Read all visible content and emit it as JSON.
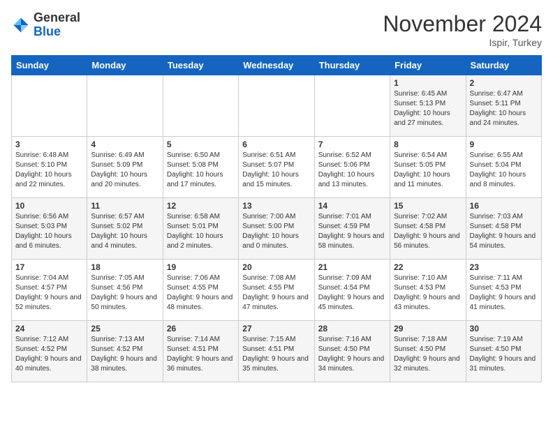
{
  "header": {
    "logo_general": "General",
    "logo_blue": "Blue",
    "month_year": "November 2024",
    "location": "Ispir, Turkey"
  },
  "days_of_week": [
    "Sunday",
    "Monday",
    "Tuesday",
    "Wednesday",
    "Thursday",
    "Friday",
    "Saturday"
  ],
  "weeks": [
    [
      {
        "day": "",
        "data": ""
      },
      {
        "day": "",
        "data": ""
      },
      {
        "day": "",
        "data": ""
      },
      {
        "day": "",
        "data": ""
      },
      {
        "day": "",
        "data": ""
      },
      {
        "day": "1",
        "data": "Sunrise: 6:45 AM\nSunset: 5:13 PM\nDaylight: 10 hours and 27 minutes."
      },
      {
        "day": "2",
        "data": "Sunrise: 6:47 AM\nSunset: 5:11 PM\nDaylight: 10 hours and 24 minutes."
      }
    ],
    [
      {
        "day": "3",
        "data": "Sunrise: 6:48 AM\nSunset: 5:10 PM\nDaylight: 10 hours and 22 minutes."
      },
      {
        "day": "4",
        "data": "Sunrise: 6:49 AM\nSunset: 5:09 PM\nDaylight: 10 hours and 20 minutes."
      },
      {
        "day": "5",
        "data": "Sunrise: 6:50 AM\nSunset: 5:08 PM\nDaylight: 10 hours and 17 minutes."
      },
      {
        "day": "6",
        "data": "Sunrise: 6:51 AM\nSunset: 5:07 PM\nDaylight: 10 hours and 15 minutes."
      },
      {
        "day": "7",
        "data": "Sunrise: 6:52 AM\nSunset: 5:06 PM\nDaylight: 10 hours and 13 minutes."
      },
      {
        "day": "8",
        "data": "Sunrise: 6:54 AM\nSunset: 5:05 PM\nDaylight: 10 hours and 11 minutes."
      },
      {
        "day": "9",
        "data": "Sunrise: 6:55 AM\nSunset: 5:04 PM\nDaylight: 10 hours and 8 minutes."
      }
    ],
    [
      {
        "day": "10",
        "data": "Sunrise: 6:56 AM\nSunset: 5:03 PM\nDaylight: 10 hours and 6 minutes."
      },
      {
        "day": "11",
        "data": "Sunrise: 6:57 AM\nSunset: 5:02 PM\nDaylight: 10 hours and 4 minutes."
      },
      {
        "day": "12",
        "data": "Sunrise: 6:58 AM\nSunset: 5:01 PM\nDaylight: 10 hours and 2 minutes."
      },
      {
        "day": "13",
        "data": "Sunrise: 7:00 AM\nSunset: 5:00 PM\nDaylight: 10 hours and 0 minutes."
      },
      {
        "day": "14",
        "data": "Sunrise: 7:01 AM\nSunset: 4:59 PM\nDaylight: 9 hours and 58 minutes."
      },
      {
        "day": "15",
        "data": "Sunrise: 7:02 AM\nSunset: 4:58 PM\nDaylight: 9 hours and 56 minutes."
      },
      {
        "day": "16",
        "data": "Sunrise: 7:03 AM\nSunset: 4:58 PM\nDaylight: 9 hours and 54 minutes."
      }
    ],
    [
      {
        "day": "17",
        "data": "Sunrise: 7:04 AM\nSunset: 4:57 PM\nDaylight: 9 hours and 52 minutes."
      },
      {
        "day": "18",
        "data": "Sunrise: 7:05 AM\nSunset: 4:56 PM\nDaylight: 9 hours and 50 minutes."
      },
      {
        "day": "19",
        "data": "Sunrise: 7:06 AM\nSunset: 4:55 PM\nDaylight: 9 hours and 48 minutes."
      },
      {
        "day": "20",
        "data": "Sunrise: 7:08 AM\nSunset: 4:55 PM\nDaylight: 9 hours and 47 minutes."
      },
      {
        "day": "21",
        "data": "Sunrise: 7:09 AM\nSunset: 4:54 PM\nDaylight: 9 hours and 45 minutes."
      },
      {
        "day": "22",
        "data": "Sunrise: 7:10 AM\nSunset: 4:53 PM\nDaylight: 9 hours and 43 minutes."
      },
      {
        "day": "23",
        "data": "Sunrise: 7:11 AM\nSunset: 4:53 PM\nDaylight: 9 hours and 41 minutes."
      }
    ],
    [
      {
        "day": "24",
        "data": "Sunrise: 7:12 AM\nSunset: 4:52 PM\nDaylight: 9 hours and 40 minutes."
      },
      {
        "day": "25",
        "data": "Sunrise: 7:13 AM\nSunset: 4:52 PM\nDaylight: 9 hours and 38 minutes."
      },
      {
        "day": "26",
        "data": "Sunrise: 7:14 AM\nSunset: 4:51 PM\nDaylight: 9 hours and 36 minutes."
      },
      {
        "day": "27",
        "data": "Sunrise: 7:15 AM\nSunset: 4:51 PM\nDaylight: 9 hours and 35 minutes."
      },
      {
        "day": "28",
        "data": "Sunrise: 7:16 AM\nSunset: 4:50 PM\nDaylight: 9 hours and 34 minutes."
      },
      {
        "day": "29",
        "data": "Sunrise: 7:18 AM\nSunset: 4:50 PM\nDaylight: 9 hours and 32 minutes."
      },
      {
        "day": "30",
        "data": "Sunrise: 7:19 AM\nSunset: 4:50 PM\nDaylight: 9 hours and 31 minutes."
      }
    ]
  ]
}
